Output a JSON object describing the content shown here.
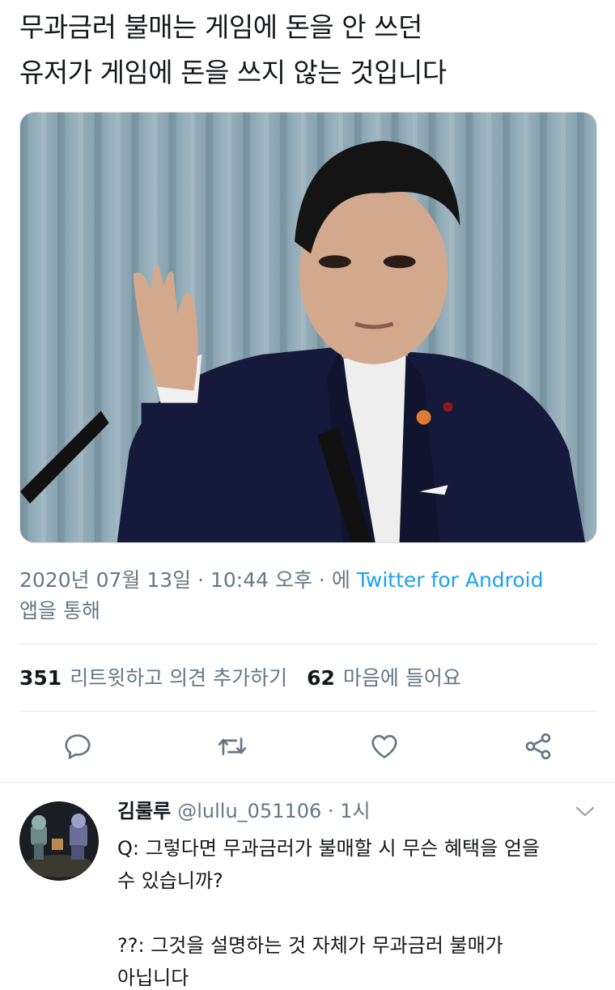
{
  "tweet": {
    "text_lines": [
      "무과금러 불매는 게임에 돈을 안 쓰던",
      "유저가 게임에 돈을 쓰지 않는 것입니다"
    ],
    "timestamp": "2020년 07월 13일 · 10:44 오후 · 에",
    "source": "Twitter for Android",
    "via": "앱을 통해",
    "retweet_count": "351",
    "retweet_label": "리트윗하고 의견 추가하기",
    "like_count": "62",
    "like_label": "마음에 들어요"
  },
  "actions": [
    {
      "icon": "reply-icon"
    },
    {
      "icon": "retweet-icon"
    },
    {
      "icon": "like-icon"
    },
    {
      "icon": "share-icon"
    }
  ],
  "reply": {
    "name": "김룰루",
    "handle": "@lullu_051106",
    "time": "· 1시",
    "lines": [
      "Q: 그렇다면 무과금러가 불매할 시 무슨 혜택을 얻을",
      "수 있습니까?",
      "??: 그것을 설명하는 것 자체가 무과금러 불매가",
      "아닙니다"
    ]
  },
  "colors": {
    "text": "#14171a",
    "secondary": "#657786",
    "link": "#1da1f2",
    "divider": "#e1e8ed"
  }
}
